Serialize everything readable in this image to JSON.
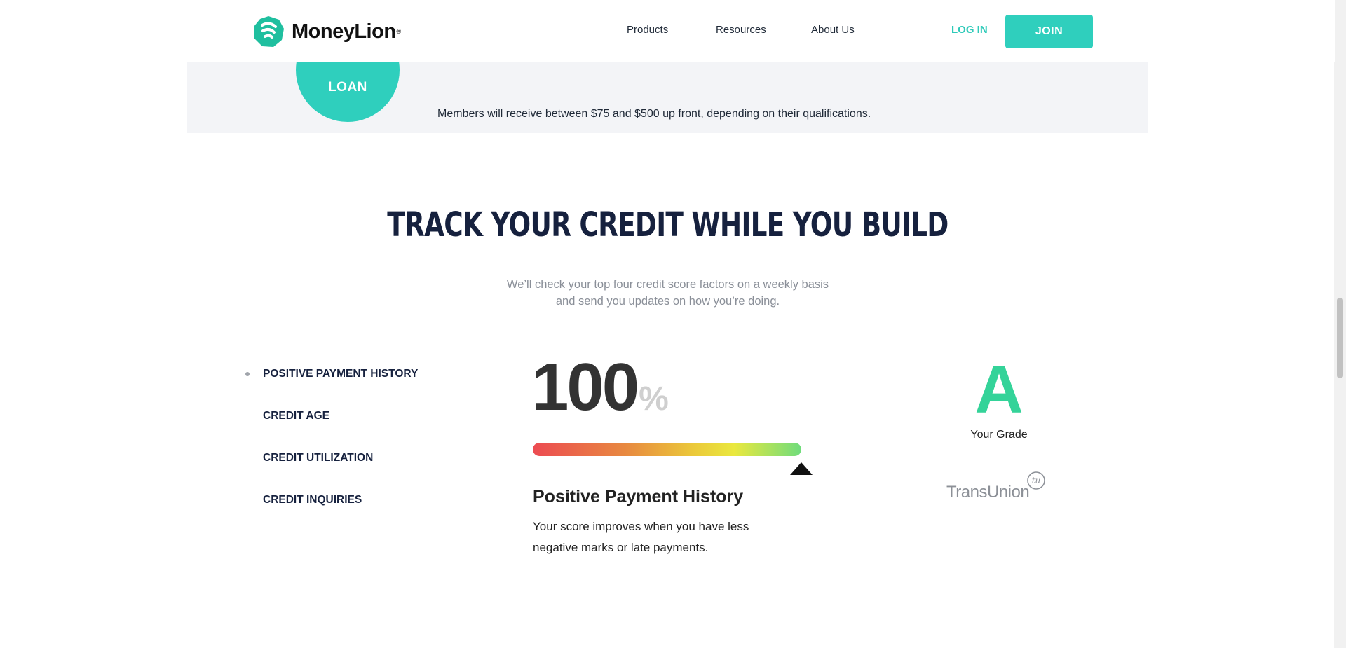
{
  "header": {
    "brand": "MoneyLion",
    "brand_mark": "®",
    "nav": [
      "Products",
      "Resources",
      "About Us"
    ],
    "login_label": "LOG IN",
    "join_label": "JOIN"
  },
  "band": {
    "badge_text": "LOAN",
    "note": "Members will receive between $75 and $500 up front, depending on their qualifications."
  },
  "section": {
    "title": "TRACK YOUR CREDIT WHILE YOU BUILD",
    "subtitle_line1": "We’ll check your top four credit score factors on a weekly basis",
    "subtitle_line2": "and send you updates on how you’re doing."
  },
  "factors": [
    {
      "label": "POSITIVE PAYMENT HISTORY",
      "active": true
    },
    {
      "label": "CREDIT AGE",
      "active": false
    },
    {
      "label": "CREDIT UTILIZATION",
      "active": false
    },
    {
      "label": "CREDIT INQUIRIES",
      "active": false
    }
  ],
  "score": {
    "value": "100",
    "unit": "%",
    "level": 1.0,
    "factor_title": "Positive Payment History",
    "factor_description": "Your score improves when you have less negative marks or late payments."
  },
  "grade": {
    "letter": "A",
    "label": "Your Grade",
    "provider": "TransUnion",
    "provider_mark": "tu"
  },
  "colors": {
    "accent": "#2fcfbd",
    "grade": "#34d399",
    "heading": "#16213e"
  }
}
